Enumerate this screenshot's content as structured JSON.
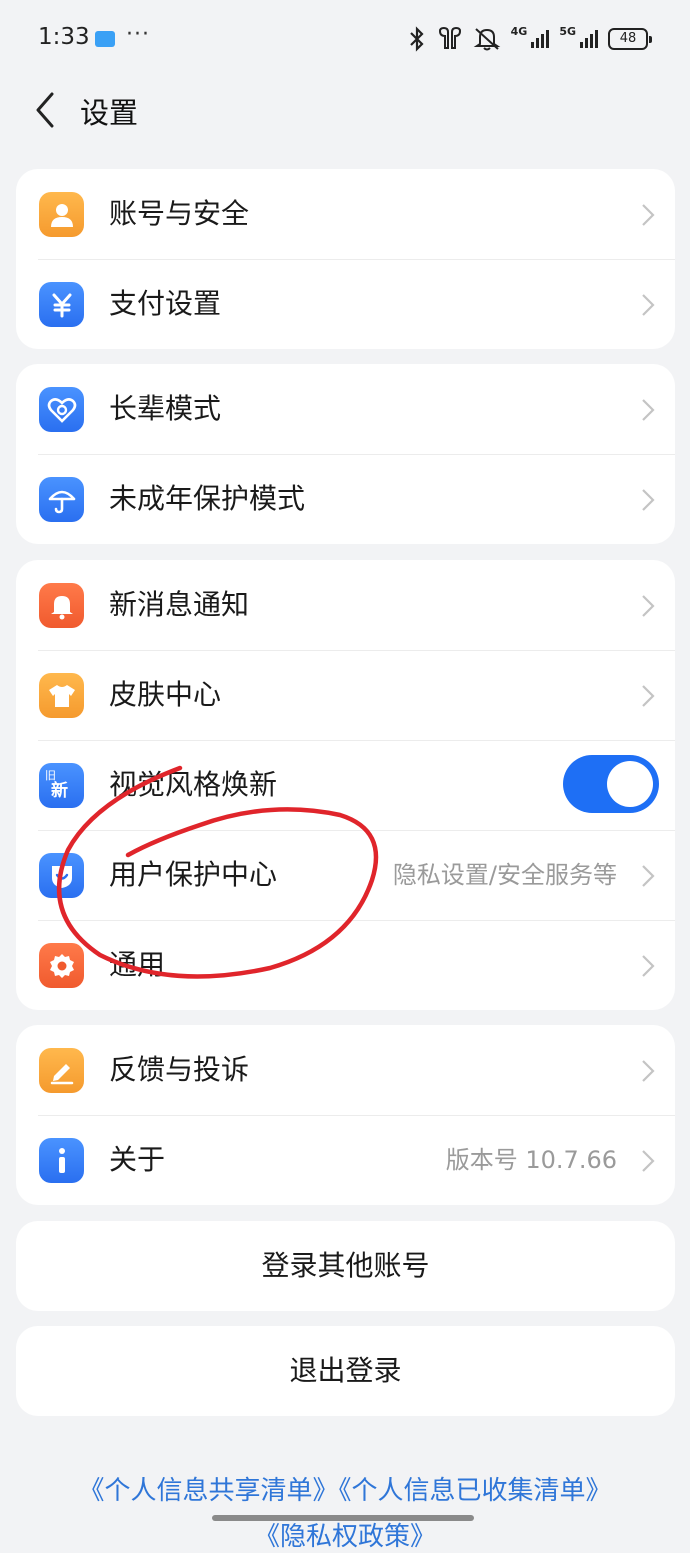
{
  "status_bar": {
    "time": "1:33",
    "more": "···",
    "network_1": "4G",
    "network_2": "5G",
    "battery": "48"
  },
  "header": {
    "title": "设置"
  },
  "groups": [
    {
      "items": [
        {
          "label": "账号与安全",
          "icon": "user-icon",
          "color": "#f8a33a"
        },
        {
          "label": "支付设置",
          "icon": "yen-icon",
          "color": "#2f7bf0"
        }
      ]
    },
    {
      "items": [
        {
          "label": "长辈模式",
          "icon": "heart-icon",
          "color": "#2f7bf0"
        },
        {
          "label": "未成年保护模式",
          "icon": "umbrella-icon",
          "color": "#2f7bf0"
        }
      ]
    },
    {
      "items": [
        {
          "label": "新消息通知",
          "icon": "bell-icon",
          "color": "#f5673a"
        },
        {
          "label": "皮肤中心",
          "icon": "tshirt-icon",
          "color": "#f8a33a"
        },
        {
          "label": "视觉风格焕新",
          "icon": "style-icon",
          "color": "#2f7bf0",
          "icon_text_1": "旧",
          "icon_text_2": "新",
          "toggle_on": true
        },
        {
          "label": "用户保护中心",
          "icon": "shield-icon",
          "color": "#2f7bf0",
          "value": "隐私设置/安全服务等"
        },
        {
          "label": "通用",
          "icon": "gear-icon",
          "color": "#f5673a"
        }
      ]
    },
    {
      "items": [
        {
          "label": "反馈与投诉",
          "icon": "pencil-icon",
          "color": "#f8a33a"
        },
        {
          "label": "关于",
          "icon": "info-icon",
          "color": "#2f7bf0",
          "value": "版本号 10.7.66"
        }
      ]
    }
  ],
  "buttons": {
    "switch_account": "登录其他账号",
    "logout": "退出登录"
  },
  "footer": {
    "link_1": "《个人信息共享清单》",
    "link_2": "《个人信息已收集清单》",
    "link_3": "《隐私权政策》"
  },
  "colors": {
    "accent": "#1e6ff5",
    "annotation": "#e0252b",
    "link": "#2f76d8"
  }
}
